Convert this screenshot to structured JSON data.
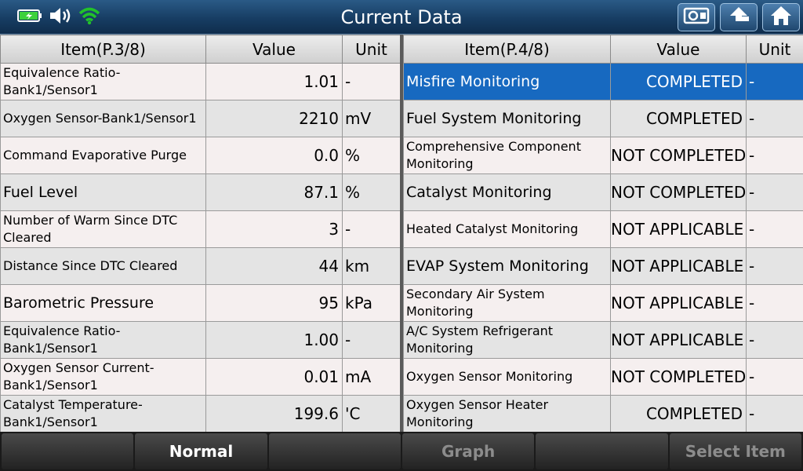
{
  "header": {
    "title": "Current Data"
  },
  "icons": {
    "battery": "battery-icon",
    "volume": "speaker-icon",
    "wifi": "wifi-icon",
    "nav": [
      "camera-icon",
      "back-arrow-icon",
      "home-icon"
    ]
  },
  "left_table": {
    "headers": [
      "Item(P.3/8)",
      "Value",
      "Unit"
    ],
    "rows": [
      {
        "item": "Equivalence Ratio-Bank1/Sensor1",
        "value": "1.01",
        "unit": "-"
      },
      {
        "item": "Oxygen Sensor-Bank1/Sensor1",
        "value": "2210",
        "unit": "mV"
      },
      {
        "item": "Command Evaporative Purge",
        "value": "0.0",
        "unit": "%"
      },
      {
        "item": "Fuel Level",
        "value": "87.1",
        "unit": "%"
      },
      {
        "item": "Number of Warm Since DTC Cleared",
        "value": "3",
        "unit": "-"
      },
      {
        "item": "Distance Since DTC Cleared",
        "value": "44",
        "unit": "km"
      },
      {
        "item": "Barometric Pressure",
        "value": "95",
        "unit": "kPa"
      },
      {
        "item": "Equivalence Ratio-Bank1/Sensor1",
        "value": "1.00",
        "unit": "-"
      },
      {
        "item": "Oxygen Sensor Current-Bank1/Sensor1",
        "value": "0.01",
        "unit": "mA"
      },
      {
        "item": "Catalyst Temperature-Bank1/Sensor1",
        "value": "199.6",
        "unit": "'C"
      }
    ]
  },
  "right_table": {
    "headers": [
      "Item(P.4/8)",
      "Value",
      "Unit"
    ],
    "rows": [
      {
        "item": "Misfire Monitoring",
        "value": "COMPLETED",
        "unit": "-"
      },
      {
        "item": "Fuel System Monitoring",
        "value": "COMPLETED",
        "unit": "-"
      },
      {
        "item": "Comprehensive Component Monitoring",
        "value": "NOT COMPLETED",
        "unit": "-"
      },
      {
        "item": "Catalyst Monitoring",
        "value": "NOT COMPLETED",
        "unit": "-"
      },
      {
        "item": "Heated Catalyst Monitoring",
        "value": "NOT APPLICABLE",
        "unit": "-"
      },
      {
        "item": "EVAP System Monitoring",
        "value": "NOT APPLICABLE",
        "unit": "-"
      },
      {
        "item": "Secondary Air System Monitoring",
        "value": "NOT APPLICABLE",
        "unit": "-"
      },
      {
        "item": "A/C System Refrigerant Monitoring",
        "value": "NOT APPLICABLE",
        "unit": "-"
      },
      {
        "item": "Oxygen Sensor Monitoring",
        "value": "NOT COMPLETED",
        "unit": "-"
      },
      {
        "item": "Oxygen Sensor Heater Monitoring",
        "value": "COMPLETED",
        "unit": "-"
      }
    ]
  },
  "toolbar": {
    "buttons": [
      "",
      "Normal",
      "",
      "Graph",
      "",
      "Select Item"
    ]
  },
  "colors": {
    "selected_row": "#1769c0",
    "wifi": "#22c22a",
    "battery": "#3cd13c"
  }
}
